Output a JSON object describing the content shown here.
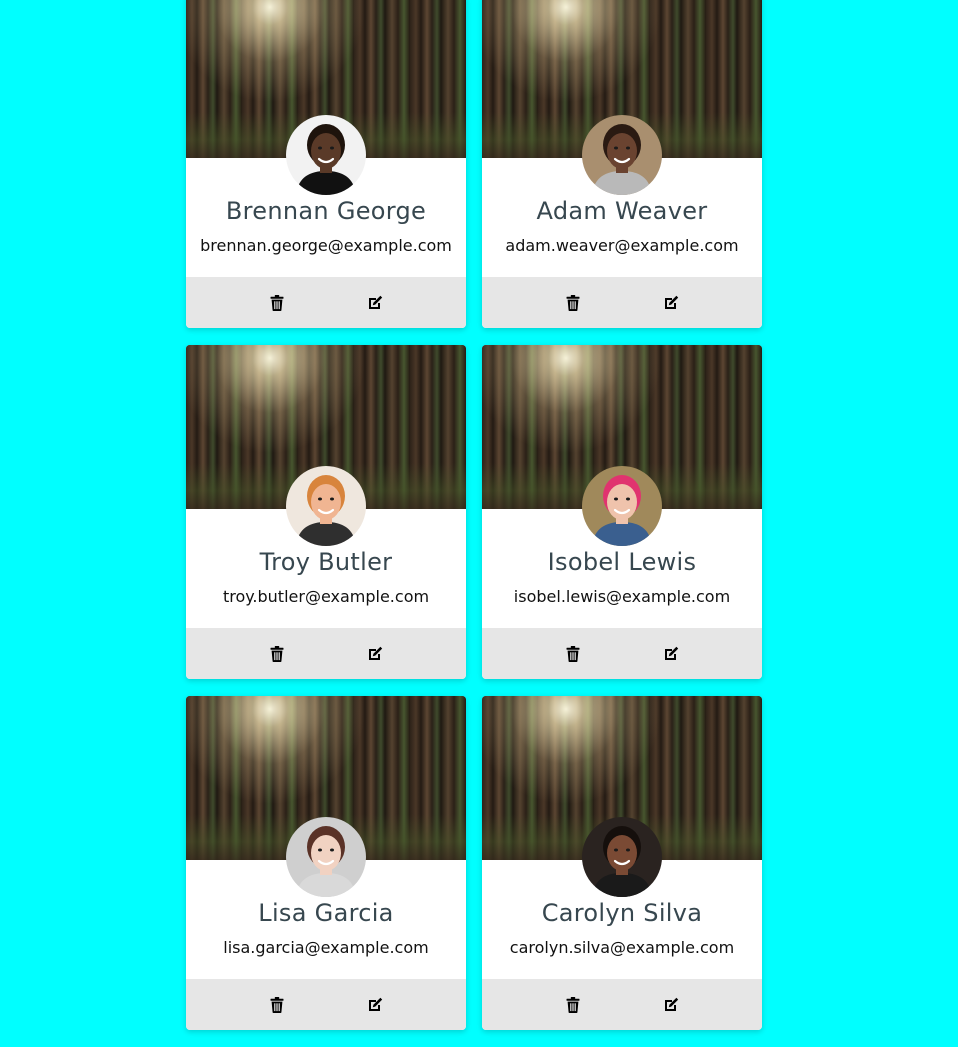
{
  "background_color": "#00ffff",
  "contacts": [
    {
      "name": "Brennan George",
      "email": "brennan.george@example.com",
      "avatar": {
        "skin": "#5a3a28",
        "hair": "#1e130c",
        "shirt": "#111111",
        "bg": "#f2f2f2"
      }
    },
    {
      "name": "Adam Weaver",
      "email": "adam.weaver@example.com",
      "avatar": {
        "skin": "#6a4330",
        "hair": "#2a1a12",
        "shirt": "#b9b9b9",
        "bg": "#a98f6f"
      }
    },
    {
      "name": "Troy Butler",
      "email": "troy.butler@example.com",
      "avatar": {
        "skin": "#f0b592",
        "hair": "#d8843c",
        "shirt": "#2f2f2f",
        "bg": "#efe7de"
      }
    },
    {
      "name": "Isobel Lewis",
      "email": "isobel.lewis@example.com",
      "avatar": {
        "skin": "#efc3ac",
        "hair": "#e0336f",
        "shirt": "#3a5f8f",
        "bg": "#a0895b"
      }
    },
    {
      "name": "Lisa Garcia",
      "email": "lisa.garcia@example.com",
      "avatar": {
        "skin": "#f1d2c2",
        "hair": "#5a3227",
        "shirt": "#d9d9d9",
        "bg": "#cfcfcf"
      }
    },
    {
      "name": "Carolyn Silva",
      "email": "carolyn.silva@example.com",
      "avatar": {
        "skin": "#7a4a34",
        "hair": "#150f0c",
        "shirt": "#1a1a1a",
        "bg": "#2a2320"
      }
    }
  ],
  "icons": {
    "delete": "trash-icon",
    "edit": "edit-icon"
  }
}
